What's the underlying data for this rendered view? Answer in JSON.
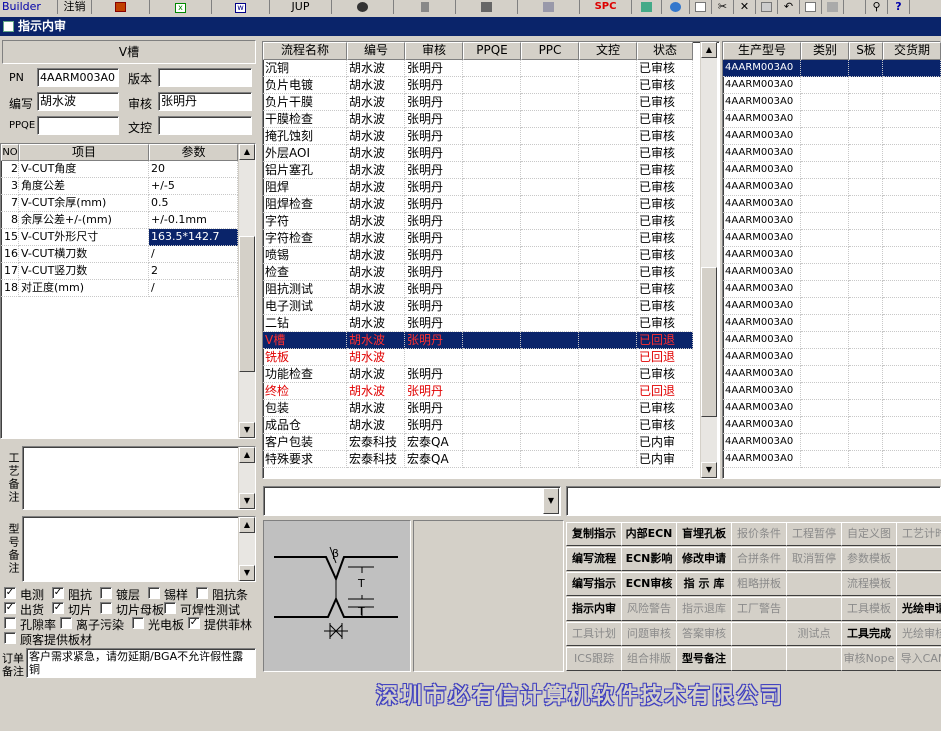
{
  "toolbar": {
    "builder_label": "Builder",
    "cancel_label": "注销",
    "jup_label": "JUP",
    "spc_label": "SPC",
    "icons": [
      "table-icon",
      "excel-icon",
      "word-icon",
      "jup",
      "eye-icon",
      "server-icon",
      "network-icon",
      "printer-icon",
      "export-icon",
      "ie-icon",
      "page-icon",
      "cut-icon",
      "close-icon",
      "paste-icon",
      "undo-icon",
      "preview-icon",
      "print-icon",
      "find-icon",
      "help-icon"
    ]
  },
  "window": {
    "title": "指示内审"
  },
  "left": {
    "section_title": "V槽",
    "pn_label": "PN",
    "pn_value": "4AARM003A0",
    "version_label": "版本",
    "version_value": "",
    "writer_label": "编写",
    "writer_value": "胡水波",
    "reviewer_label": "审核",
    "reviewer_value": "张明丹",
    "ppqe_label": "PPQE",
    "ppqe_value": "",
    "doc_label": "文控",
    "doc_value": "",
    "param_headers": [
      "NO",
      "项目",
      "参数"
    ],
    "params": [
      {
        "no": "2",
        "item": "V-CUT角度",
        "value": "20"
      },
      {
        "no": "3",
        "item": "角度公差",
        "value": "+/-5"
      },
      {
        "no": "7",
        "item": "V-CUT余厚(mm)",
        "value": "0.5"
      },
      {
        "no": "8",
        "item": "余厚公差+/-(mm)",
        "value": "+/-0.1mm"
      },
      {
        "no": "15",
        "item": "V-CUT外形尺寸",
        "value": "163.5*142.7"
      },
      {
        "no": "16",
        "item": "V-CUT横刀数",
        "value": "/"
      },
      {
        "no": "17",
        "item": "V-CUT竖刀数",
        "value": "2"
      },
      {
        "no": "18",
        "item": "对正度(mm)",
        "value": "/"
      }
    ],
    "process_note_label": "工艺备注",
    "model_note_label": "型号备注",
    "checkboxes": [
      {
        "label": "电测",
        "checked": true
      },
      {
        "label": "阻抗",
        "checked": true
      },
      {
        "label": "镀层",
        "checked": false
      },
      {
        "label": "锡样",
        "checked": false
      },
      {
        "label": "阻抗条",
        "checked": false
      },
      {
        "label": "出货",
        "checked": true
      },
      {
        "label": "切片",
        "checked": true
      },
      {
        "label": "切片母板",
        "checked": false
      },
      {
        "label": "可焊性测试",
        "checked": false
      },
      {
        "label": "孔隙率",
        "checked": false
      },
      {
        "label": "离子污染",
        "checked": false
      },
      {
        "label": "光电板",
        "checked": false
      },
      {
        "label": "提供菲林",
        "checked": true
      },
      {
        "label": "顾客提供板材",
        "checked": false
      }
    ],
    "order_note_label": "订单备注",
    "order_note_text": "客户需求紧急，请勿延期/BGA不允许假性露铜"
  },
  "flow": {
    "headers": [
      "流程名称",
      "编号",
      "审核",
      "PPQE",
      "PPC",
      "文控",
      "状态"
    ],
    "rows": [
      {
        "name": "沉铜",
        "no": "胡水波",
        "review": "张明丹",
        "ppqe": "",
        "ppc": "",
        "doc": "",
        "status": "已审核",
        "state": "normal"
      },
      {
        "name": "负片电镀",
        "no": "胡水波",
        "review": "张明丹",
        "ppqe": "",
        "ppc": "",
        "doc": "",
        "status": "已审核",
        "state": "normal"
      },
      {
        "name": "负片干膜",
        "no": "胡水波",
        "review": "张明丹",
        "ppqe": "",
        "ppc": "",
        "doc": "",
        "status": "已审核",
        "state": "normal"
      },
      {
        "name": "干膜检查",
        "no": "胡水波",
        "review": "张明丹",
        "ppqe": "",
        "ppc": "",
        "doc": "",
        "status": "已审核",
        "state": "normal"
      },
      {
        "name": "掩孔蚀刻",
        "no": "胡水波",
        "review": "张明丹",
        "ppqe": "",
        "ppc": "",
        "doc": "",
        "status": "已审核",
        "state": "normal"
      },
      {
        "name": "外层AOI",
        "no": "胡水波",
        "review": "张明丹",
        "ppqe": "",
        "ppc": "",
        "doc": "",
        "status": "已审核",
        "state": "normal"
      },
      {
        "name": "铝片塞孔",
        "no": "胡水波",
        "review": "张明丹",
        "ppqe": "",
        "ppc": "",
        "doc": "",
        "status": "已审核",
        "state": "normal"
      },
      {
        "name": "阻焊",
        "no": "胡水波",
        "review": "张明丹",
        "ppqe": "",
        "ppc": "",
        "doc": "",
        "status": "已审核",
        "state": "normal"
      },
      {
        "name": "阻焊检查",
        "no": "胡水波",
        "review": "张明丹",
        "ppqe": "",
        "ppc": "",
        "doc": "",
        "status": "已审核",
        "state": "normal"
      },
      {
        "name": "字符",
        "no": "胡水波",
        "review": "张明丹",
        "ppqe": "",
        "ppc": "",
        "doc": "",
        "status": "已审核",
        "state": "normal"
      },
      {
        "name": "字符检查",
        "no": "胡水波",
        "review": "张明丹",
        "ppqe": "",
        "ppc": "",
        "doc": "",
        "status": "已审核",
        "state": "normal"
      },
      {
        "name": "喷锡",
        "no": "胡水波",
        "review": "张明丹",
        "ppqe": "",
        "ppc": "",
        "doc": "",
        "status": "已审核",
        "state": "normal"
      },
      {
        "name": "检查",
        "no": "胡水波",
        "review": "张明丹",
        "ppqe": "",
        "ppc": "",
        "doc": "",
        "status": "已审核",
        "state": "normal"
      },
      {
        "name": "阻抗测试",
        "no": "胡水波",
        "review": "张明丹",
        "ppqe": "",
        "ppc": "",
        "doc": "",
        "status": "已审核",
        "state": "normal"
      },
      {
        "name": "电子测试",
        "no": "胡水波",
        "review": "张明丹",
        "ppqe": "",
        "ppc": "",
        "doc": "",
        "status": "已审核",
        "state": "normal"
      },
      {
        "name": "二钻",
        "no": "胡水波",
        "review": "张明丹",
        "ppqe": "",
        "ppc": "",
        "doc": "",
        "status": "已审核",
        "state": "normal"
      },
      {
        "name": "V槽",
        "no": "胡水波",
        "review": "张明丹",
        "ppqe": "",
        "ppc": "",
        "doc": "",
        "status": "已回退",
        "state": "selected"
      },
      {
        "name": "铣板",
        "no": "胡水波",
        "review": "",
        "ppqe": "",
        "ppc": "",
        "doc": "",
        "status": "已回退",
        "state": "red"
      },
      {
        "name": "功能检查",
        "no": "胡水波",
        "review": "张明丹",
        "ppqe": "",
        "ppc": "",
        "doc": "",
        "status": "已审核",
        "state": "normal"
      },
      {
        "name": "终检",
        "no": "胡水波",
        "review": "张明丹",
        "ppqe": "",
        "ppc": "",
        "doc": "",
        "status": "已回退",
        "state": "red"
      },
      {
        "name": "包装",
        "no": "胡水波",
        "review": "张明丹",
        "ppqe": "",
        "ppc": "",
        "doc": "",
        "status": "已审核",
        "state": "normal"
      },
      {
        "name": "成品仓",
        "no": "胡水波",
        "review": "张明丹",
        "ppqe": "",
        "ppc": "",
        "doc": "",
        "status": "已审核",
        "state": "normal"
      },
      {
        "name": "客户包装",
        "no": "宏泰科技",
        "review": "宏泰QA",
        "ppqe": "",
        "ppc": "",
        "doc": "",
        "status": "已内审",
        "state": "normal"
      },
      {
        "name": "特殊要求",
        "no": "宏泰科技",
        "review": "宏泰QA",
        "ppqe": "",
        "ppc": "",
        "doc": "",
        "status": "已内审",
        "state": "normal"
      }
    ]
  },
  "models": {
    "headers": [
      "生产型号",
      "类别",
      "S板",
      "交货期"
    ],
    "rows": [
      "4AARM003A0",
      "4AARM003A0",
      "4AARM003A0",
      "4AARM003A0",
      "4AARM003A0",
      "4AARM003A0",
      "4AARM003A0",
      "4AARM003A0",
      "4AARM003A0",
      "4AARM003A0",
      "4AARM003A0",
      "4AARM003A0",
      "4AARM003A0",
      "4AARM003A0",
      "4AARM003A0",
      "4AARM003A0",
      "4AARM003A0",
      "4AARM003A0",
      "4AARM003A0",
      "4AARM003A0",
      "4AARM003A0",
      "4AARM003A0",
      "4AARM003A0",
      "4AARM003A0"
    ]
  },
  "diagram": {
    "label_beta": "β",
    "label_t1": "T",
    "label_t2": "T"
  },
  "buttons": [
    [
      "复制指示",
      "内部ECN",
      "盲埋孔板",
      "报价条件",
      "工程暂停",
      "自定义图",
      "工艺计时"
    ],
    [
      "编写流程",
      "ECN影响",
      "修改申请",
      "合拼条件",
      "取消暂停",
      "参数模板",
      ""
    ],
    [
      "编写指示",
      "ECN审核",
      "指 示 库",
      "粗略拼板",
      "",
      "流程模板",
      ""
    ],
    [
      "指示内审",
      "风险警告",
      "指示退库",
      "工厂警告",
      "",
      "工具模板",
      "光绘申请"
    ],
    [
      "工具计划",
      "问题审核",
      "答案审核",
      "",
      "测试点",
      "工具完成",
      "光绘审核"
    ],
    [
      "ICS跟踪",
      "组合排版",
      "型号备注",
      "",
      "",
      "审核Nope",
      "导入CAM"
    ]
  ],
  "button_states": [
    [
      "bold",
      "bold",
      "bold",
      "dis",
      "dis",
      "dis",
      "dis"
    ],
    [
      "bold",
      "bold",
      "bold",
      "dis",
      "dis",
      "dis",
      "empty"
    ],
    [
      "bold",
      "bold",
      "bold",
      "dis",
      "empty",
      "dis",
      "empty"
    ],
    [
      "bold",
      "dis",
      "dis",
      "dis",
      "empty",
      "dis",
      "bold"
    ],
    [
      "dis",
      "dis",
      "dis",
      "empty",
      "dis",
      "bold",
      "dis"
    ],
    [
      "dis",
      "dis",
      "bold",
      "empty",
      "empty",
      "dis",
      "dis"
    ]
  ],
  "footer_text": "深圳市必有信计算机软件技术有限公司"
}
